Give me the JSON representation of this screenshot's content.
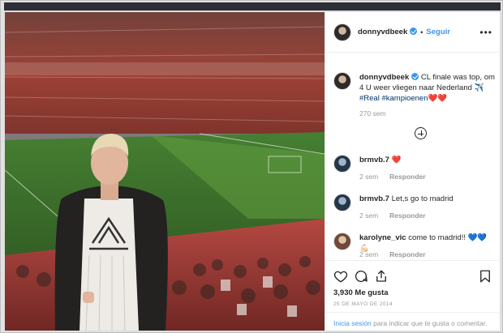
{
  "post": {
    "username": "donnyvdbeek",
    "follow_label": "Seguir",
    "dot": "•",
    "more_label": "•••"
  },
  "caption": {
    "username": "donnyvdbeek",
    "text": " CL finale was top, om 4 U weer vliegen naar Nederland ✈️",
    "hashtags": "#Real #kampioenen",
    "emoji": "❤️❤️",
    "time": "270 sem"
  },
  "comments": [
    {
      "username": "brmvb.7",
      "text": " ❤️",
      "time": "2 sem",
      "reply_label": "Responder"
    },
    {
      "username": "brmvb.7",
      "text": " Let,s go to madrid",
      "time": "2 sem",
      "reply_label": "Responder"
    },
    {
      "username": "karolyne_vic",
      "text": " come to madrid!! 💙💙💪🏻",
      "time": "2 sem",
      "reply_label": "Responder"
    }
  ],
  "actions": {
    "icons": [
      "heart-icon",
      "comment-icon",
      "share-icon",
      "bookmark-icon"
    ],
    "likes": "3,930 Me gusta",
    "date": "25 DE MAYO DE 2014"
  },
  "login_prompt": {
    "link": "Inicia sesión",
    "text": " para indicar que te gusta o comentar."
  },
  "colors": {
    "accent": "#3897f0",
    "text": "#262626",
    "muted": "#999999",
    "heart": "#ed4956"
  }
}
